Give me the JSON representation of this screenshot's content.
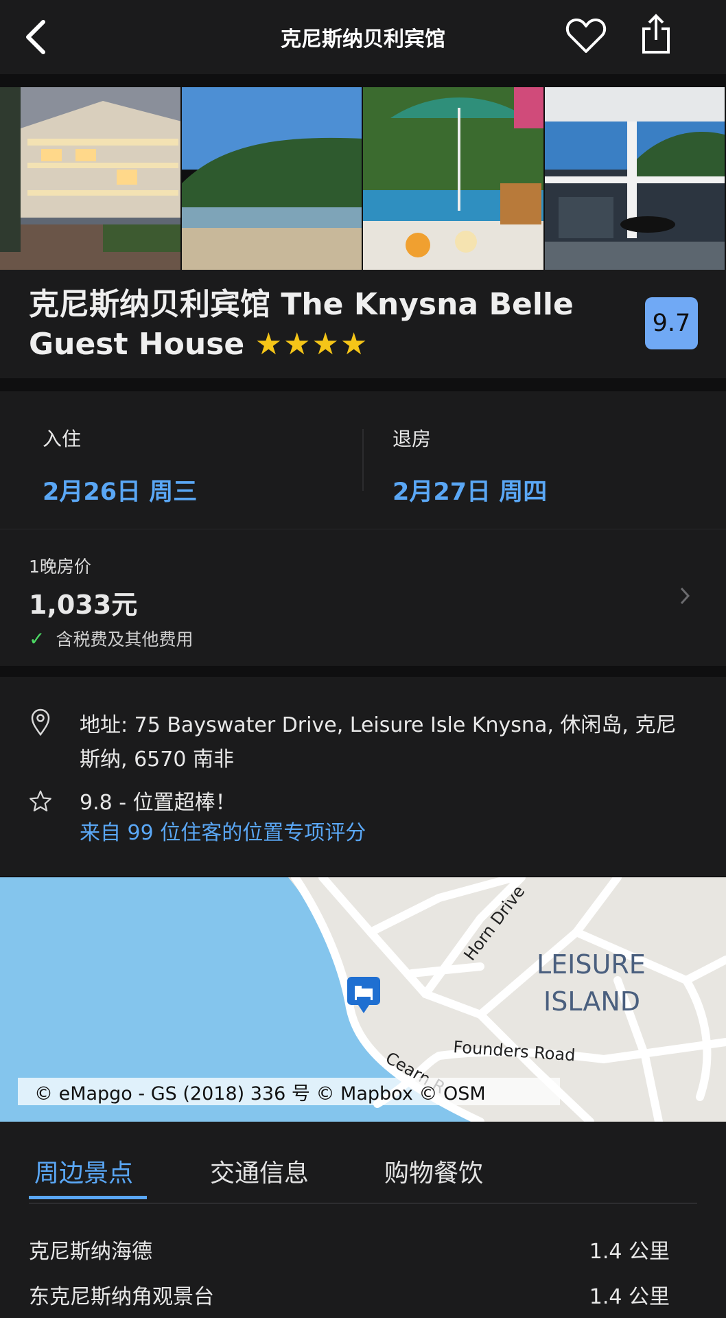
{
  "header": {
    "title": "克尼斯纳贝利宾馆"
  },
  "colors": {
    "accent": "#5aa7f5",
    "star": "#f5c518",
    "check": "#4cd964",
    "badge": "#70a9f5"
  },
  "hotel": {
    "name": "克尼斯纳贝利宾馆 The Knysna Belle Guest House",
    "stars": "★★★★",
    "star_count": 4,
    "score": "9.7"
  },
  "dates": {
    "checkin_label": "入住",
    "checkin_value": "2月26日 周三",
    "checkout_label": "退房",
    "checkout_value": "2月27日 周四"
  },
  "price": {
    "label": "1晚房价",
    "value": "1,033元",
    "note": "含税费及其他费用"
  },
  "info": {
    "address": "地址: 75 Bayswater Drive, Leisure Isle Knysna, 休闲岛, 克尼斯纳, 6570 南非",
    "location_score": "9.8 - 位置超棒！",
    "location_link": "来自 99 位住客的位置专项评分"
  },
  "map": {
    "labels": {
      "island": "LEISURE",
      "island2": "ISLAND",
      "horn": "Horn Drive",
      "founders": "Founders Road",
      "cearn": "Cearn R"
    },
    "attribution": "© eMapgo - GS (2018) 336 号   © Mapbox   © OSM"
  },
  "nearby": {
    "tabs": [
      "周边景点",
      "交通信息",
      "购物餐饮"
    ],
    "items": [
      {
        "name": "克尼斯纳海德",
        "distance": "1.4 公里"
      },
      {
        "name": "东克尼斯纳角观景台",
        "distance": "1.4 公里"
      }
    ]
  }
}
